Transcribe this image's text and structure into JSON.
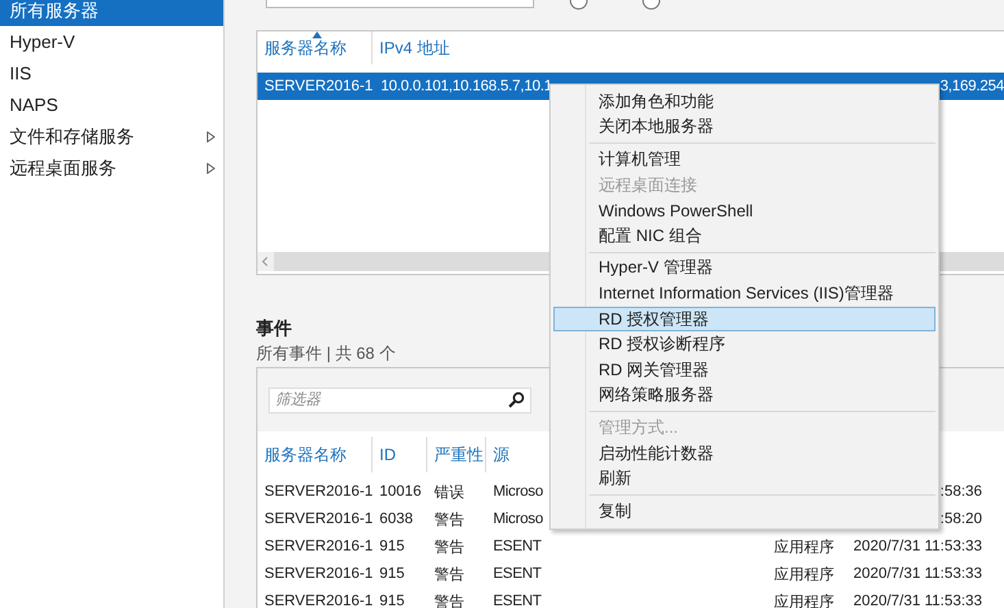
{
  "sidebar": {
    "items": [
      {
        "label": "所有服务器",
        "selected": true,
        "submenu": false
      },
      {
        "label": "Hyper-V",
        "selected": false,
        "submenu": false
      },
      {
        "label": "IIS",
        "selected": false,
        "submenu": false
      },
      {
        "label": "NAPS",
        "selected": false,
        "submenu": false
      },
      {
        "label": "文件和存储服务",
        "selected": false,
        "submenu": true
      },
      {
        "label": "远程桌面服务",
        "selected": false,
        "submenu": true
      }
    ]
  },
  "servers": {
    "radios": [
      {
        "selected": false
      },
      {
        "selected": false
      }
    ],
    "columns": [
      "服务器名称",
      "IPv4 地址"
    ],
    "rows": [
      {
        "name": "SERVER2016-1",
        "ipv4": "10.0.0.101,10.168.5.7,10.1",
        "ipv4_tail": "3,169.254",
        "selected": true
      }
    ]
  },
  "events": {
    "title": "事件",
    "subtitle": "所有事件 | 共 68 个",
    "filter": {
      "placeholder": "筛选器"
    },
    "columns": [
      "服务器名称",
      "ID",
      "严重性",
      "源"
    ],
    "rows": [
      {
        "server": "SERVER2016-1",
        "id": "10016",
        "severity": "错误",
        "source": "Microso",
        "log": "",
        "time": ":58:36"
      },
      {
        "server": "SERVER2016-1",
        "id": "6038",
        "severity": "警告",
        "source": "Microso",
        "log": "",
        "time": ":58:20"
      },
      {
        "server": "SERVER2016-1",
        "id": "915",
        "severity": "警告",
        "source": "ESENT",
        "log": "应用程序",
        "time": "2020/7/31 11:53:33"
      },
      {
        "server": "SERVER2016-1",
        "id": "915",
        "severity": "警告",
        "source": "ESENT",
        "log": "应用程序",
        "time": "2020/7/31 11:53:33"
      },
      {
        "server": "SERVER2016-1",
        "id": "915",
        "severity": "警告",
        "source": "ESENT",
        "log": "应用程序",
        "time": "2020/7/31 11:53:33"
      }
    ]
  },
  "context_menu": {
    "items": [
      {
        "kind": "item",
        "label": "添加角色和功能",
        "disabled": false,
        "selected": false
      },
      {
        "kind": "item",
        "label": "关闭本地服务器",
        "disabled": false,
        "selected": false
      },
      {
        "kind": "separator"
      },
      {
        "kind": "item",
        "label": "计算机管理",
        "disabled": false,
        "selected": false
      },
      {
        "kind": "item",
        "label": "远程桌面连接",
        "disabled": true,
        "selected": false
      },
      {
        "kind": "item",
        "label": "Windows PowerShell",
        "disabled": false,
        "selected": false
      },
      {
        "kind": "item",
        "label": "配置 NIC 组合",
        "disabled": false,
        "selected": false
      },
      {
        "kind": "separator"
      },
      {
        "kind": "item",
        "label": "Hyper-V 管理器",
        "disabled": false,
        "selected": false
      },
      {
        "kind": "item",
        "label": "Internet Information Services (IIS)管理器",
        "disabled": false,
        "selected": false
      },
      {
        "kind": "item",
        "label": "RD 授权管理器",
        "disabled": false,
        "selected": true
      },
      {
        "kind": "item",
        "label": "RD 授权诊断程序",
        "disabled": false,
        "selected": false
      },
      {
        "kind": "item",
        "label": "RD 网关管理器",
        "disabled": false,
        "selected": false
      },
      {
        "kind": "item",
        "label": "网络策略服务器",
        "disabled": false,
        "selected": false
      },
      {
        "kind": "separator"
      },
      {
        "kind": "item",
        "label": "管理方式...",
        "disabled": true,
        "selected": false
      },
      {
        "kind": "item",
        "label": "启动性能计数器",
        "disabled": false,
        "selected": false
      },
      {
        "kind": "item",
        "label": "刷新",
        "disabled": false,
        "selected": false
      },
      {
        "kind": "separator"
      },
      {
        "kind": "item",
        "label": "复制",
        "disabled": false,
        "selected": false
      }
    ]
  }
}
